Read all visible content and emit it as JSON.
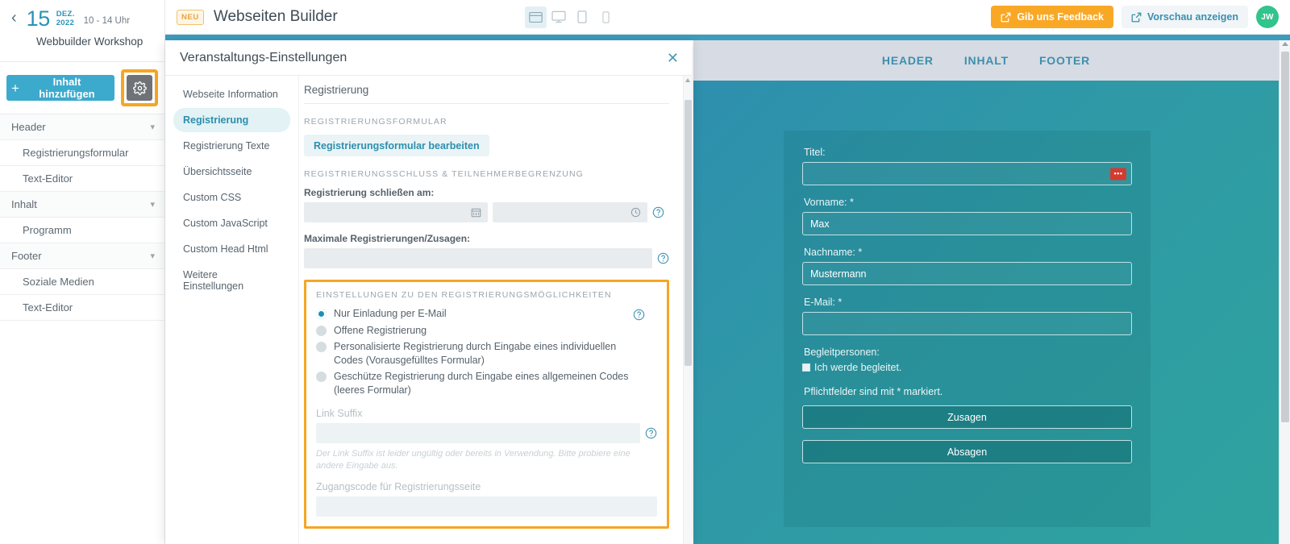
{
  "sidebar": {
    "back_icon": "chevron-left-icon",
    "day": "15",
    "month": "DEZ.",
    "year": "2022",
    "time_range": "10 - 14 Uhr",
    "event_title": "Webbuilder Workshop",
    "add_content_label": "Inhalt hinzufügen",
    "gear_icon": "gear-icon",
    "items": [
      {
        "label": "Header",
        "type": "group"
      },
      {
        "label": "Registrierungsformular",
        "type": "child"
      },
      {
        "label": "Text-Editor",
        "type": "child"
      },
      {
        "label": "Inhalt",
        "type": "group"
      },
      {
        "label": "Programm",
        "type": "child"
      },
      {
        "label": "Footer",
        "type": "group"
      },
      {
        "label": "Soziale Medien",
        "type": "child"
      },
      {
        "label": "Text-Editor",
        "type": "child"
      }
    ]
  },
  "topbar": {
    "badge": "NEU",
    "title": "Webseiten Builder",
    "devices": [
      {
        "name": "browser-view-icon",
        "active": true
      },
      {
        "name": "desktop-view-icon",
        "active": false
      },
      {
        "name": "tablet-view-icon",
        "active": false
      },
      {
        "name": "mobile-view-icon",
        "active": false
      }
    ],
    "feedback_label": "Gib uns Feedback",
    "preview_label": "Vorschau anzeigen",
    "avatar_initials": "JW",
    "accent_orange": "#f9a825",
    "accent_teal": "#3a8fb0",
    "avatar_green": "#31c48d"
  },
  "modal": {
    "title": "Veranstaltungs-Einstellungen",
    "close_icon": "close-icon",
    "nav": [
      {
        "label": "Webseite Information",
        "active": false
      },
      {
        "label": "Registrierung",
        "active": true
      },
      {
        "label": "Registrierung Texte",
        "active": false
      },
      {
        "label": "Übersichtsseite",
        "active": false
      },
      {
        "label": "Custom CSS",
        "active": false
      },
      {
        "label": "Custom JavaScript",
        "active": false
      },
      {
        "label": "Custom Head Html",
        "active": false
      },
      {
        "label": "Weitere Einstellungen",
        "active": false
      }
    ],
    "content": {
      "heading": "Registrierung",
      "section_form": "REGISTRIERUNGSFORMULAR",
      "edit_form_button": "Registrierungsformular bearbeiten",
      "section_deadline": "REGISTRIERUNGSSCHLUSS & TEILNEHMERBEGRENZUNG",
      "close_on_label": "Registrierung schließen am:",
      "close_on_date_value": "",
      "close_on_time_value": "",
      "max_label": "Maximale Registrierungen/Zusagen:",
      "max_value": "",
      "highlighted_section": "EINSTELLUNGEN ZU DEN REGISTRIERUNGSMÖGLICHKEITEN",
      "options": [
        {
          "label": "Nur Einladung per E-Mail",
          "selected": true
        },
        {
          "label": "Offene Registrierung",
          "selected": false
        },
        {
          "label": "Personalisierte Registrierung durch Eingabe eines individuellen Codes (Vorausgefülltes Formular)",
          "selected": false
        },
        {
          "label": "Geschütze Registrierung durch Eingabe eines allgemeinen Codes (leeres Formular)",
          "selected": false
        }
      ],
      "link_suffix_label": "Link Suffix",
      "link_suffix_value": "",
      "link_suffix_error": "Der Link Suffix ist leider ungültig oder bereits in Verwendung. Bitte probiere eine andere Eingabe aus.",
      "access_code_label": "Zugangscode für Registrierungsseite",
      "access_code_value": "",
      "highlight_color": "#f5a623",
      "calendar_icon": "calendar-icon",
      "clock_icon": "clock-icon",
      "help_icon": "help-circle-icon"
    }
  },
  "preview": {
    "nav": [
      "HEADER",
      "INHALT",
      "FOOTER"
    ],
    "fields": [
      {
        "label": "Titel:",
        "value": "",
        "badge": "•••"
      },
      {
        "label": "Vorname: *",
        "value": "Max"
      },
      {
        "label": "Nachname: *",
        "value": "Mustermann"
      },
      {
        "label": "E-Mail: *",
        "value": ""
      }
    ],
    "companions_label": "Begleitpersonen:",
    "companions_checkbox_label": "Ich werde begleitet.",
    "required_note": "Pflichtfelder sind mit * markiert.",
    "accept_button": "Zusagen",
    "decline_button": "Absagen"
  }
}
